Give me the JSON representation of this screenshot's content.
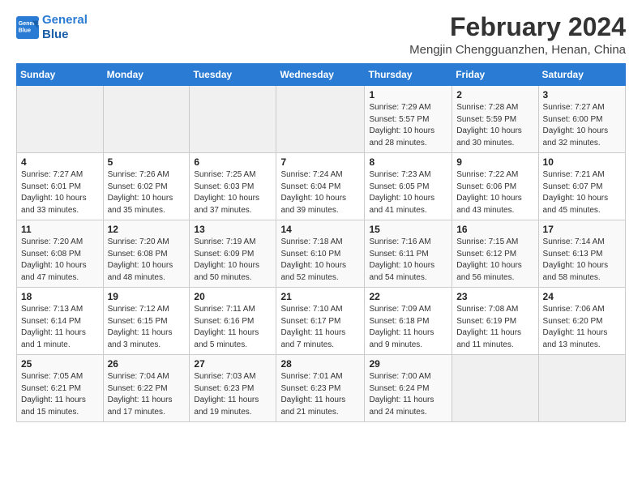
{
  "logo": {
    "line1": "General",
    "line2": "Blue"
  },
  "title": "February 2024",
  "subtitle": "Mengjin Chengguanzhen, Henan, China",
  "header": {
    "days": [
      "Sunday",
      "Monday",
      "Tuesday",
      "Wednesday",
      "Thursday",
      "Friday",
      "Saturday"
    ]
  },
  "weeks": [
    [
      {
        "day": "",
        "info": ""
      },
      {
        "day": "",
        "info": ""
      },
      {
        "day": "",
        "info": ""
      },
      {
        "day": "",
        "info": ""
      },
      {
        "day": "1",
        "info": "Sunrise: 7:29 AM\nSunset: 5:57 PM\nDaylight: 10 hours\nand 28 minutes."
      },
      {
        "day": "2",
        "info": "Sunrise: 7:28 AM\nSunset: 5:59 PM\nDaylight: 10 hours\nand 30 minutes."
      },
      {
        "day": "3",
        "info": "Sunrise: 7:27 AM\nSunset: 6:00 PM\nDaylight: 10 hours\nand 32 minutes."
      }
    ],
    [
      {
        "day": "4",
        "info": "Sunrise: 7:27 AM\nSunset: 6:01 PM\nDaylight: 10 hours\nand 33 minutes."
      },
      {
        "day": "5",
        "info": "Sunrise: 7:26 AM\nSunset: 6:02 PM\nDaylight: 10 hours\nand 35 minutes."
      },
      {
        "day": "6",
        "info": "Sunrise: 7:25 AM\nSunset: 6:03 PM\nDaylight: 10 hours\nand 37 minutes."
      },
      {
        "day": "7",
        "info": "Sunrise: 7:24 AM\nSunset: 6:04 PM\nDaylight: 10 hours\nand 39 minutes."
      },
      {
        "day": "8",
        "info": "Sunrise: 7:23 AM\nSunset: 6:05 PM\nDaylight: 10 hours\nand 41 minutes."
      },
      {
        "day": "9",
        "info": "Sunrise: 7:22 AM\nSunset: 6:06 PM\nDaylight: 10 hours\nand 43 minutes."
      },
      {
        "day": "10",
        "info": "Sunrise: 7:21 AM\nSunset: 6:07 PM\nDaylight: 10 hours\nand 45 minutes."
      }
    ],
    [
      {
        "day": "11",
        "info": "Sunrise: 7:20 AM\nSunset: 6:08 PM\nDaylight: 10 hours\nand 47 minutes."
      },
      {
        "day": "12",
        "info": "Sunrise: 7:20 AM\nSunset: 6:08 PM\nDaylight: 10 hours\nand 48 minutes."
      },
      {
        "day": "13",
        "info": "Sunrise: 7:19 AM\nSunset: 6:09 PM\nDaylight: 10 hours\nand 50 minutes."
      },
      {
        "day": "14",
        "info": "Sunrise: 7:18 AM\nSunset: 6:10 PM\nDaylight: 10 hours\nand 52 minutes."
      },
      {
        "day": "15",
        "info": "Sunrise: 7:16 AM\nSunset: 6:11 PM\nDaylight: 10 hours\nand 54 minutes."
      },
      {
        "day": "16",
        "info": "Sunrise: 7:15 AM\nSunset: 6:12 PM\nDaylight: 10 hours\nand 56 minutes."
      },
      {
        "day": "17",
        "info": "Sunrise: 7:14 AM\nSunset: 6:13 PM\nDaylight: 10 hours\nand 58 minutes."
      }
    ],
    [
      {
        "day": "18",
        "info": "Sunrise: 7:13 AM\nSunset: 6:14 PM\nDaylight: 11 hours\nand 1 minute."
      },
      {
        "day": "19",
        "info": "Sunrise: 7:12 AM\nSunset: 6:15 PM\nDaylight: 11 hours\nand 3 minutes."
      },
      {
        "day": "20",
        "info": "Sunrise: 7:11 AM\nSunset: 6:16 PM\nDaylight: 11 hours\nand 5 minutes."
      },
      {
        "day": "21",
        "info": "Sunrise: 7:10 AM\nSunset: 6:17 PM\nDaylight: 11 hours\nand 7 minutes."
      },
      {
        "day": "22",
        "info": "Sunrise: 7:09 AM\nSunset: 6:18 PM\nDaylight: 11 hours\nand 9 minutes."
      },
      {
        "day": "23",
        "info": "Sunrise: 7:08 AM\nSunset: 6:19 PM\nDaylight: 11 hours\nand 11 minutes."
      },
      {
        "day": "24",
        "info": "Sunrise: 7:06 AM\nSunset: 6:20 PM\nDaylight: 11 hours\nand 13 minutes."
      }
    ],
    [
      {
        "day": "25",
        "info": "Sunrise: 7:05 AM\nSunset: 6:21 PM\nDaylight: 11 hours\nand 15 minutes."
      },
      {
        "day": "26",
        "info": "Sunrise: 7:04 AM\nSunset: 6:22 PM\nDaylight: 11 hours\nand 17 minutes."
      },
      {
        "day": "27",
        "info": "Sunrise: 7:03 AM\nSunset: 6:23 PM\nDaylight: 11 hours\nand 19 minutes."
      },
      {
        "day": "28",
        "info": "Sunrise: 7:01 AM\nSunset: 6:23 PM\nDaylight: 11 hours\nand 21 minutes."
      },
      {
        "day": "29",
        "info": "Sunrise: 7:00 AM\nSunset: 6:24 PM\nDaylight: 11 hours\nand 24 minutes."
      },
      {
        "day": "",
        "info": ""
      },
      {
        "day": "",
        "info": ""
      }
    ]
  ]
}
